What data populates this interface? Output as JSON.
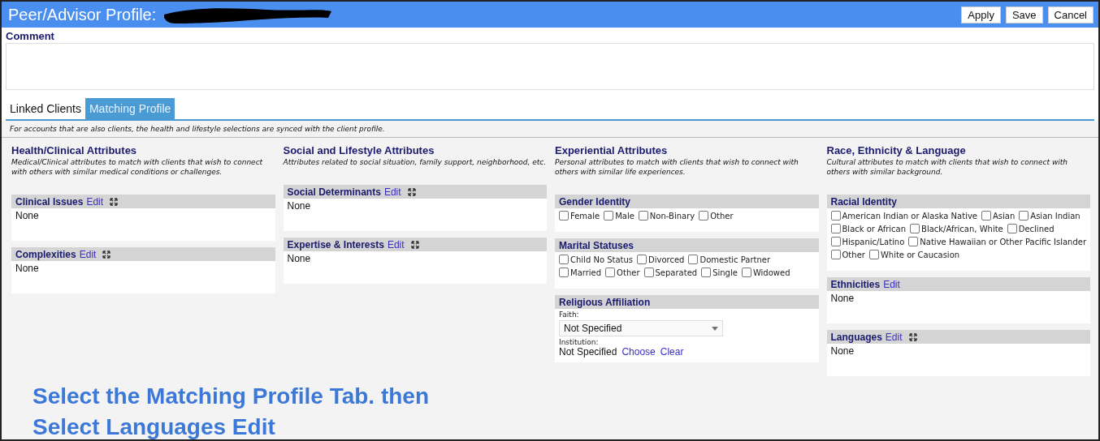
{
  "header": {
    "title": "Peer/Advisor Profile:",
    "redacted": true,
    "buttons": [
      "Apply",
      "Save",
      "Cancel"
    ]
  },
  "comment": {
    "label": "Comment"
  },
  "tabs": [
    {
      "label": "Linked Clients",
      "selected": false
    },
    {
      "label": "Matching Profile",
      "selected": true
    }
  ],
  "note": "For accounts that are also clients, the health and lifestyle selections are synced with the client profile.",
  "columns": [
    {
      "title": "Health/Clinical Attributes",
      "description": "Medical/Clinical attributes to match with clients that wish to connect with others with similar medical conditions or challenges.",
      "sections": [
        {
          "kind": "list",
          "title": "Clinical Issues",
          "edit": "Edit",
          "expandable": true,
          "value": "None"
        },
        {
          "kind": "list",
          "title": "Complexities",
          "edit": "Edit",
          "expandable": true,
          "value": "None"
        }
      ]
    },
    {
      "title": "Social and Lifestyle Attributes",
      "description": "Attributes related to social situation, family support, neighborhood, etc.",
      "sections": [
        {
          "kind": "list",
          "title": "Social Determinants",
          "edit": "Edit",
          "expandable": true,
          "value": "None"
        },
        {
          "kind": "list",
          "title": "Expertise & Interests",
          "edit": "Edit",
          "expandable": true,
          "value": "None"
        }
      ]
    },
    {
      "title": "Experiential Attributes",
      "description": "Personal attributes to match with clients that wish to connect with others with similar life experiences.",
      "sections": [
        {
          "kind": "checks",
          "title": "Gender Identity",
          "options": [
            {
              "label": "Female",
              "checked": false
            },
            {
              "label": "Male",
              "checked": false
            },
            {
              "label": "Non-Binary",
              "checked": false
            },
            {
              "label": "Other",
              "checked": false
            }
          ]
        },
        {
          "kind": "checks",
          "title": "Marital Statuses",
          "options": [
            {
              "label": "Child No Status",
              "checked": false
            },
            {
              "label": "Divorced",
              "checked": false
            },
            {
              "label": "Domestic Partner",
              "checked": false
            },
            {
              "label": "Married",
              "checked": false
            },
            {
              "label": "Other",
              "checked": false
            },
            {
              "label": "Separated",
              "checked": false
            },
            {
              "label": "Single",
              "checked": false
            },
            {
              "label": "Widowed",
              "checked": false
            }
          ]
        },
        {
          "kind": "religion",
          "title": "Religious Affiliation",
          "faith_label": "Faith:",
          "faith_value": "Not Specified",
          "institution_label": "Institution:",
          "institution_value": "Not Specified",
          "links": [
            "Choose",
            "Clear"
          ]
        }
      ]
    },
    {
      "title": "Race, Ethnicity & Language",
      "description": "Cultural attributes to match with clients that wish to connect with others with similar background.",
      "sections": [
        {
          "kind": "checks",
          "title": "Racial Identity",
          "options": [
            {
              "label": "American Indian or Alaska Native",
              "checked": false
            },
            {
              "label": "Asian",
              "checked": false
            },
            {
              "label": "Asian Indian",
              "checked": false
            },
            {
              "label": "Black or African",
              "checked": false
            },
            {
              "label": "Black/African, White",
              "checked": false
            },
            {
              "label": "Declined",
              "checked": false
            },
            {
              "label": "Hispanic/Latino",
              "checked": false
            },
            {
              "label": "Native Hawaiian or Other Pacific Islander",
              "checked": false
            },
            {
              "label": "Other",
              "checked": false
            },
            {
              "label": "White or Caucasion",
              "checked": false
            }
          ]
        },
        {
          "kind": "list",
          "title": "Ethnicities",
          "edit": "Edit",
          "expandable": false,
          "value": "None"
        },
        {
          "kind": "list",
          "title": "Languages",
          "edit": "Edit",
          "expandable": true,
          "value": "None"
        }
      ]
    }
  ],
  "instruction": [
    "Select the Matching Profile Tab. then",
    "Select Languages Edit"
  ]
}
